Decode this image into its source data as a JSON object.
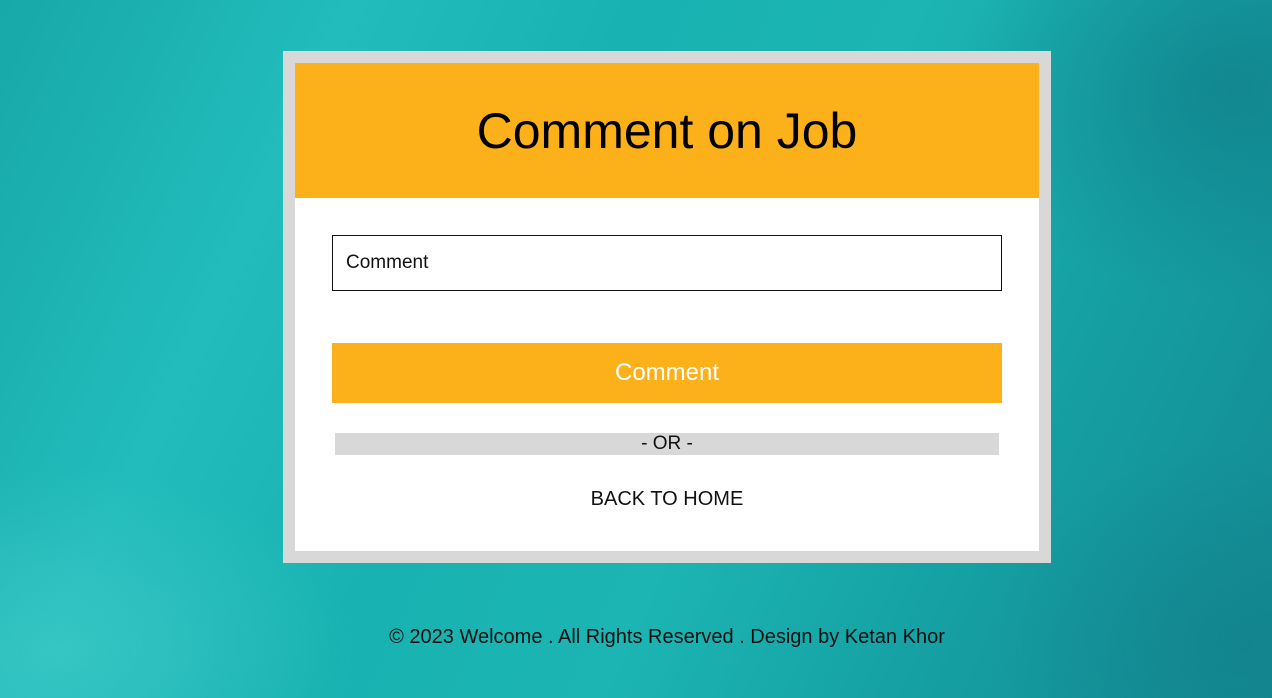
{
  "card": {
    "title": "Comment on Job",
    "comment_field": {
      "placeholder": "Comment",
      "value": ""
    },
    "submit_label": "Comment",
    "divider_text": "- OR -",
    "back_link_label": "BACK TO HOME"
  },
  "footer": {
    "text": "© 2023 Welcome . All Rights Reserved . Design by Ketan Khor"
  },
  "colors": {
    "accent": "#fcb019",
    "card_border": "#d8d8d8",
    "background": "#1cb5b3"
  }
}
